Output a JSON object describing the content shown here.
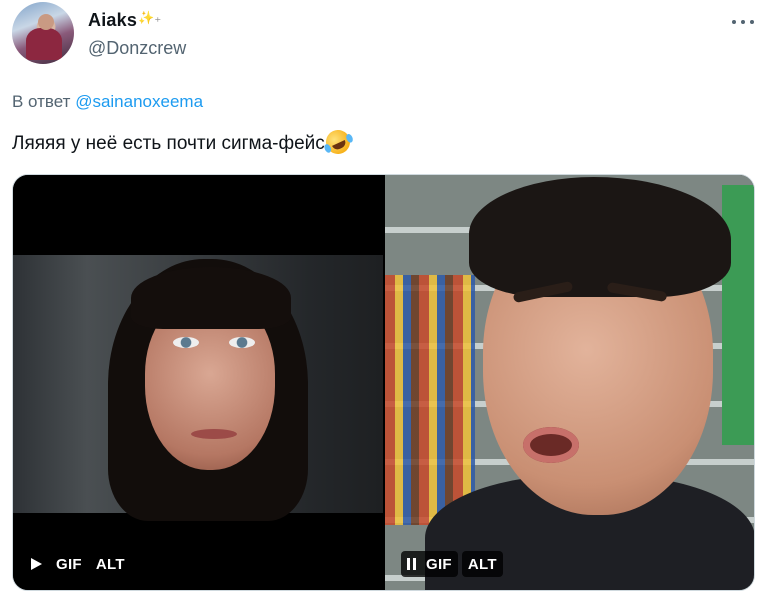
{
  "author": {
    "display_name": "Aiaks",
    "display_name_decoration": "✨₊",
    "handle": "@Donzcrew"
  },
  "reply": {
    "prefix": "В ответ",
    "mention": "@sainanoxeema"
  },
  "tweet": {
    "text": "Ляяяя у неё есть почти сигма-фейс",
    "emoji": "rolling-on-the-floor-laughing"
  },
  "media": [
    {
      "state": "paused",
      "state_icon": "play-icon",
      "type_label": "GIF",
      "alt_label": "ALT"
    },
    {
      "state": "playing",
      "state_icon": "pause-icon",
      "type_label": "GIF",
      "alt_label": "ALT"
    }
  ],
  "colors": {
    "text_primary": "#0f1419",
    "text_secondary": "#536471",
    "link": "#1d9bf0",
    "border": "#cfd9de"
  }
}
